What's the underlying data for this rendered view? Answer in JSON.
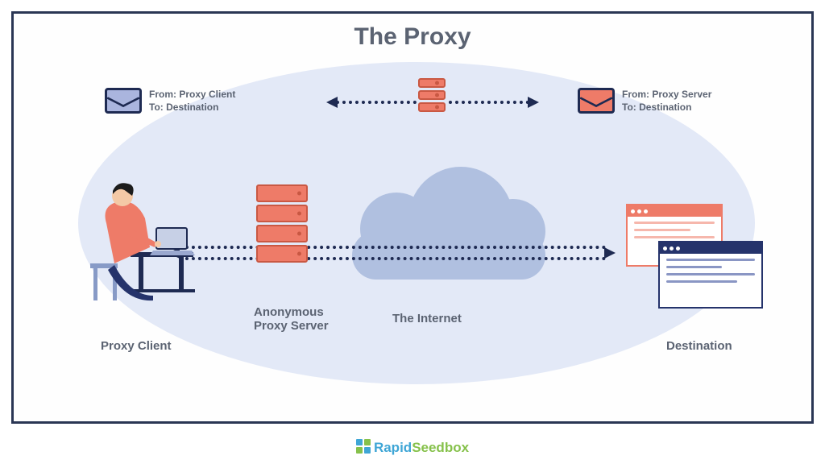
{
  "title": "The Proxy",
  "labels": {
    "proxy_client": "Proxy Client",
    "proxy_server": "Anonymous\nProxy Server",
    "internet": "The Internet",
    "destination": "Destination"
  },
  "envelopes": {
    "left": {
      "from": "From: Proxy Client",
      "to": "To: Destination"
    },
    "right": {
      "from": "From: Proxy Server",
      "to": "To: Destination"
    }
  },
  "brand": {
    "prefix": "Rapid",
    "suffix": "Seedbox"
  }
}
